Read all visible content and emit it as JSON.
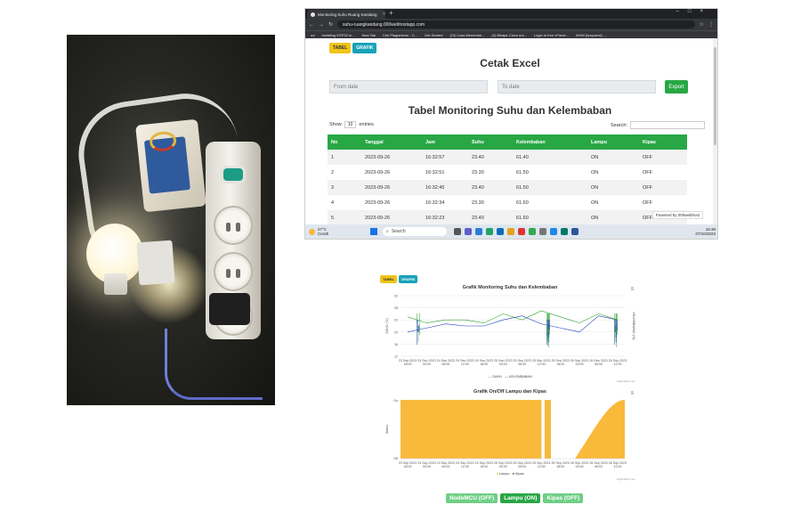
{
  "browser": {
    "tab_title": "Monitoring Suhu Ruang Kandang",
    "url": "suhu-ruangkandang.000webhostapp.com",
    "bookmarks": [
      "ud",
      "Installing ESP32 In...",
      "New Tab",
      "Cek Plagiarisme - C...",
      "Get Started",
      "(15) Cara Menentuk...",
      "(2) Belajar Cisco unt...",
      "Login to free cPanel...",
      "WHM [hpcpanel] -..."
    ]
  },
  "page": {
    "btn_tabel": "TABEL",
    "btn_grafik": "GRAFIK",
    "cetak_title": "Cetak Excel",
    "from_date_placeholder": "From date",
    "to_date_placeholder": "To date",
    "export_label": "Export",
    "table_title": "Tabel Monitoring Suhu dan Kelembaban",
    "show_label": "Show",
    "show_value": "10",
    "entries_label": "entries",
    "search_label": "Search:",
    "powered_by": "Powered by 000webhost"
  },
  "table": {
    "headers": [
      "No",
      "Tanggal",
      "Jam",
      "Suhu",
      "Kelembaban",
      "Lampu",
      "Kipas"
    ],
    "rows": [
      [
        "1",
        "2023-09-26",
        "16:32:57",
        "23.40",
        "61.40",
        "ON",
        "OFF"
      ],
      [
        "2",
        "2023-09-26",
        "16:32:51",
        "23.30",
        "61.50",
        "ON",
        "OFF"
      ],
      [
        "3",
        "2023-09-26",
        "16:32:45",
        "23.40",
        "61.50",
        "ON",
        "OFF"
      ],
      [
        "4",
        "2023-09-26",
        "16:32:34",
        "23.30",
        "61.60",
        "ON",
        "OFF"
      ],
      [
        "5",
        "2023-09-26",
        "16:32:23",
        "23.40",
        "61.60",
        "ON",
        "OFF"
      ]
    ]
  },
  "taskbar": {
    "weather_temp": "27°C",
    "weather_desc": "Cerah",
    "search_placeholder": "Search",
    "time": "16:36",
    "date": "07/10/2023"
  },
  "charts": {
    "btn_tabel": "TABEL",
    "btn_grafik": "GRAFIK",
    "chart1_title": "Grafik Monitoring Suhu dan Kelembaban",
    "chart1_legend": [
      "SUHU",
      "KELEMBABAN"
    ],
    "chart2_title": "Grafik On/Off Lampu dan Kipas",
    "chart2_legend": [
      "Lampu",
      "Kipas"
    ],
    "credit": "Highcharts.com",
    "x_ticks": [
      "23 Sep 2023 18:00",
      "24 Sep 2023 00:00",
      "24 Sep 2023 06:00",
      "24 Sep 2023 12:00",
      "24 Sep 2023 18:00",
      "25 Sep 2023 00:00",
      "25 Sep 2023 06:00",
      "25 Sep 2023 12:00",
      "25 Sep 2023 18:00",
      "26 Sep 2023 00:00",
      "26 Sep 2023 06:00",
      "26 Sep 2023 12:00"
    ],
    "y1_ticks": [
      "32",
      "28",
      "24",
      "20",
      "16",
      "12"
    ],
    "y2_ticks": [
      "On",
      "Off"
    ],
    "y1_label": "SUHU (°C)",
    "y1r_label": "KELEMBABAN (%)",
    "y2_label": "Status"
  },
  "chart_data": [
    {
      "type": "line",
      "title": "Grafik Monitoring Suhu dan Kelembaban",
      "series": [
        {
          "name": "SUHU",
          "color": "#2ca02c",
          "values": [
            25,
            23,
            24,
            24,
            23,
            26,
            24,
            27,
            25,
            23,
            26,
            24
          ]
        },
        {
          "name": "KELEMBABAN",
          "color": "#1f3fbf",
          "values": [
            52,
            54,
            56,
            55,
            55,
            58,
            60,
            56,
            54,
            52,
            60,
            58
          ]
        }
      ]
    },
    {
      "type": "area",
      "title": "Grafik On/Off Lampu dan Kipas",
      "series": [
        {
          "name": "Lampu",
          "color": "#f9b93b"
        },
        {
          "name": "Kipas",
          "color": "#333333"
        }
      ]
    }
  ],
  "status": {
    "nodemcu": "NodeMCU (OFF)",
    "lampu": "Lampu (ON)",
    "kipas": "Kipas (OFF)"
  }
}
